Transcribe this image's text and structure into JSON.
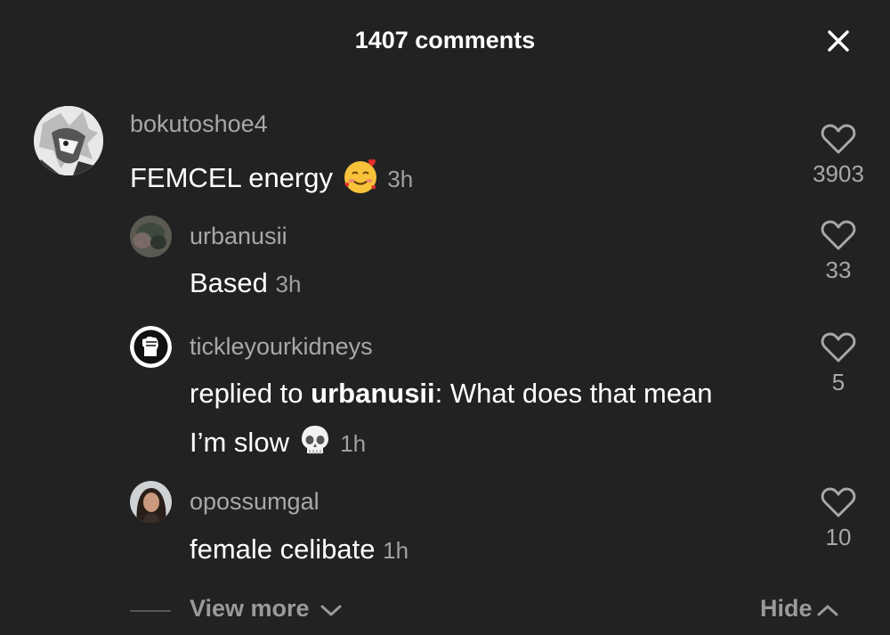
{
  "header": {
    "title": "1407 comments",
    "close_icon": "close-icon"
  },
  "comments": [
    {
      "username": "bokutoshoe4",
      "text": "FEMCEL energy",
      "emoji": "smiling-face-with-hearts",
      "time": "3h",
      "likes": "3903"
    },
    {
      "username": "urbanusii",
      "text": "Based",
      "time": "3h",
      "likes": "33"
    },
    {
      "username": "tickleyourkidneys",
      "reply_prefix": "replied to ",
      "reply_to": "urbanusii",
      "text_line1": ": What does that mean",
      "text_line2": "I’m slow",
      "emoji": "skull",
      "time": "1h",
      "likes": "5"
    },
    {
      "username": "opossumgal",
      "text": "female celibate",
      "time": "1h",
      "likes": "10"
    }
  ],
  "footer": {
    "view_more": "View more",
    "hide": "Hide"
  },
  "colors": {
    "background": "#222222",
    "text": "#ffffff",
    "muted": "#a8a8a8"
  }
}
